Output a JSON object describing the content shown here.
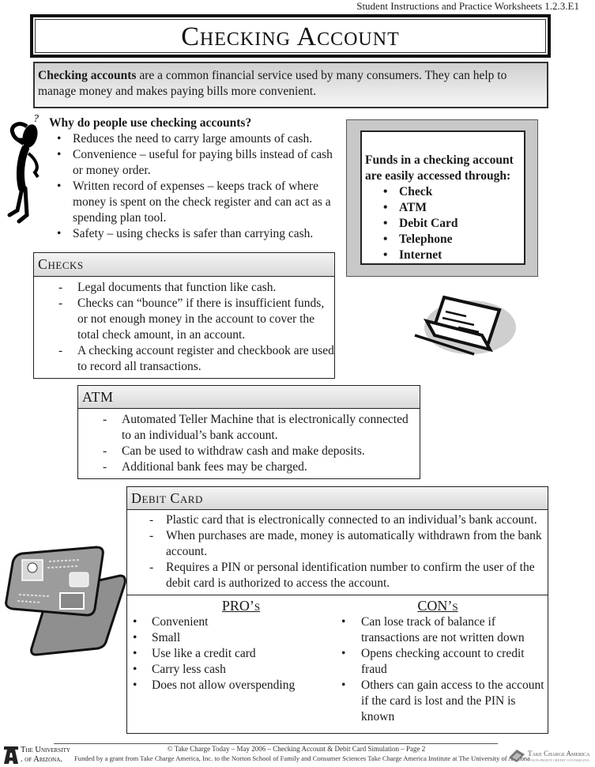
{
  "header": {
    "caption": "Student Instructions and Practice Worksheets  1.2.3.E1",
    "title": "Checking Account"
  },
  "intro": {
    "bold_term": "Checking accounts",
    "text": " are a common financial service used by many consumers.  They can help to manage money and makes paying bills more convenient."
  },
  "why": {
    "question": "Why do people use checking accounts?",
    "items": [
      "Reduces the need to carry large amounts of cash.",
      "Convenience – useful for paying bills instead of cash or money order.",
      "Written record of expenses – keeps track of where money is spent on the check register and can act as a spending plan tool.",
      "Safety – using checks is safer than carrying cash."
    ]
  },
  "funds": {
    "intro": "Funds in a checking account are easily accessed through:",
    "items": [
      "Check",
      "ATM",
      "Debit Card",
      "Telephone",
      "Internet"
    ]
  },
  "checks": {
    "heading": "Checks",
    "items": [
      "Legal documents that function like cash.",
      "Checks can “bounce” if there is insufficient funds, or not enough money in the account to cover the total check amount, in an account.",
      "A checking account register and checkbook are used to record all transactions."
    ]
  },
  "atm": {
    "heading": "ATM",
    "items": [
      "Automated Teller Machine that is electronically connected to an individual’s bank account.",
      "Can be used to withdraw cash and make deposits.",
      "Additional bank fees may be charged."
    ]
  },
  "debit": {
    "heading": "Debit Card",
    "items": [
      "Plastic card that is electronically connected to an individual’s bank account.",
      "When purchases are made, money is automatically withdrawn from the bank account.",
      "Requires a PIN or personal identification number to confirm the user of the debit card is authorized to access the account."
    ],
    "pros": {
      "title": "PRO’s",
      "items": [
        "Convenient",
        "Small",
        "Use like a credit card",
        "Carry less cash",
        "Does not allow overspending"
      ]
    },
    "cons": {
      "title": "CON’s",
      "items": [
        "Can lose track of balance if transactions are not written down",
        "Opens checking account to credit fraud",
        "Others can gain access to the account if the card is lost and the PIN is known"
      ]
    }
  },
  "footer": {
    "line1": "© Take Charge Today  – May 2006 – Checking Account & Debit Card Simulation – Page 2",
    "line2": "Funded by a grant from Take Charge America, Inc. to the Norton School of Family and Consumer Sciences Take Charge America Institute at The University of Arizona",
    "ua_line1": "The University",
    "ua_line2": ". of Arizona.",
    "tca_name": "Take Charge America",
    "tca_sub": "NON-PROFIT CREDIT COUNSELING"
  },
  "icons": {
    "thinking_figure": "thinking-person-icon",
    "checkbook": "checkbook-icon",
    "debit_cards": "debit-cards-icon",
    "ua_logo": "university-of-arizona-logo",
    "tca_logo": "take-charge-america-logo"
  }
}
